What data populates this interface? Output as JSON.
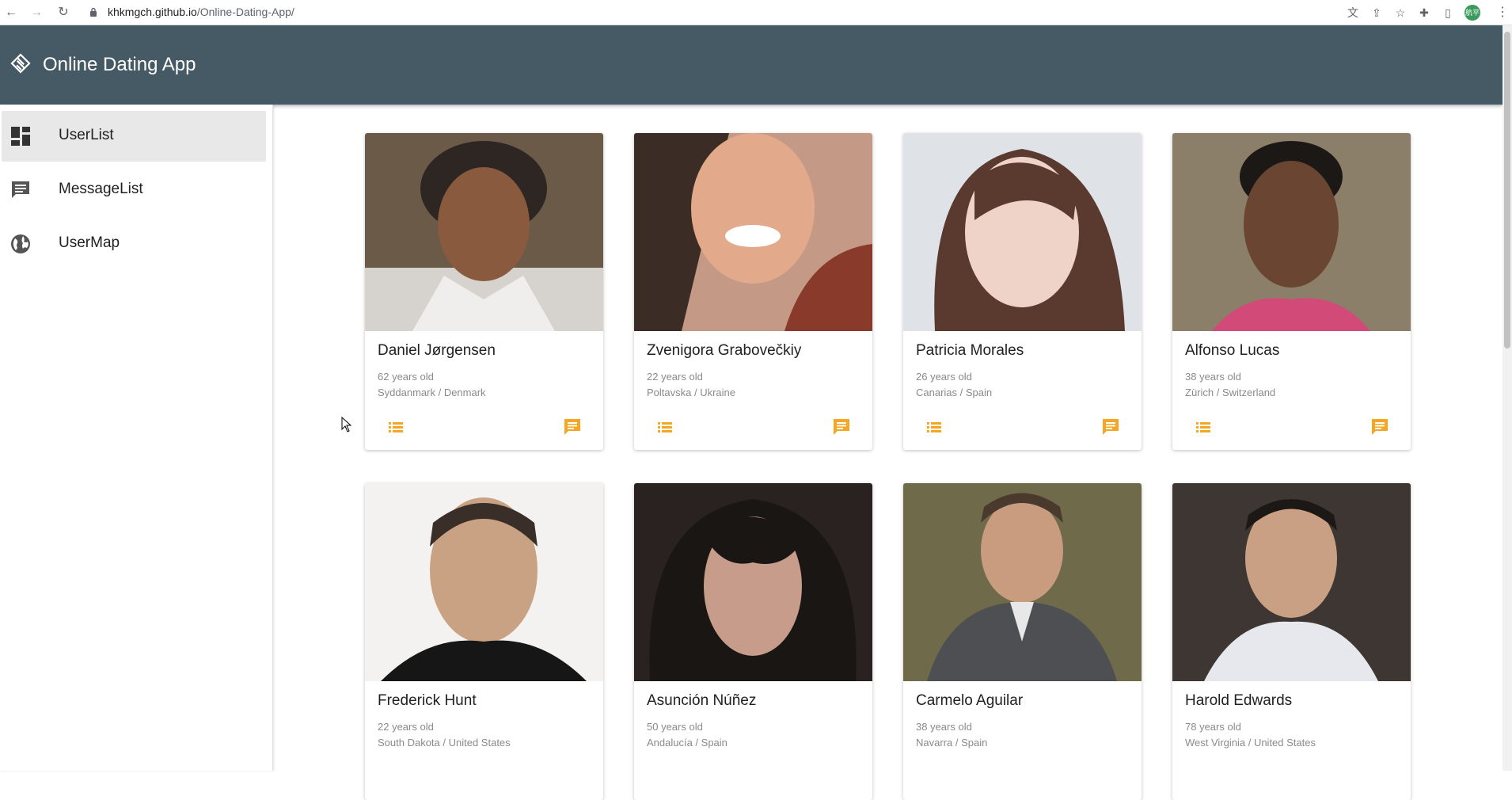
{
  "browser": {
    "url_domain": "khkmgch.github.io",
    "url_path": "/Online-Dating-App/",
    "profile_initials": "航平"
  },
  "app": {
    "title": "Online Dating App"
  },
  "sidebar": {
    "items": [
      {
        "label": "UserList",
        "icon": "dashboard-icon",
        "active": true
      },
      {
        "label": "MessageList",
        "icon": "chat-icon",
        "active": false
      },
      {
        "label": "UserMap",
        "icon": "globe-icon",
        "active": false
      }
    ]
  },
  "accent_color": "#f5a623",
  "users": [
    {
      "name": "Daniel Jørgensen",
      "age": "62 years old",
      "location": "Syddanmark / Denmark"
    },
    {
      "name": "Zvenigora Grabovečkiy",
      "age": "22 years old",
      "location": "Poltavska / Ukraine"
    },
    {
      "name": "Patricia Morales",
      "age": "26 years old",
      "location": "Canarias / Spain"
    },
    {
      "name": "Alfonso Lucas",
      "age": "38 years old",
      "location": "Zürich / Switzerland"
    },
    {
      "name": "Frederick Hunt",
      "age": "22 years old",
      "location": "South Dakota / United States"
    },
    {
      "name": "Asunción Núñez",
      "age": "50 years old",
      "location": "Andalucía / Spain"
    },
    {
      "name": "Carmelo Aguilar",
      "age": "38 years old",
      "location": "Navarra / Spain"
    },
    {
      "name": "Harold Edwards",
      "age": "78 years old",
      "location": "West Virginia / United States"
    }
  ]
}
